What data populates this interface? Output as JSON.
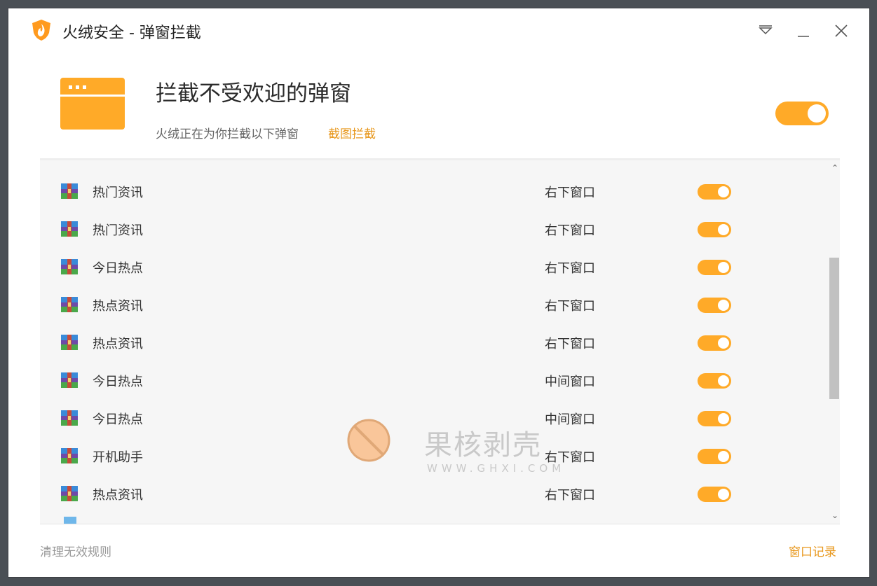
{
  "window": {
    "title": "火绒安全 - 弹窗拦截"
  },
  "header": {
    "title": "拦截不受欢迎的弹窗",
    "subtitle": "火绒正在为你拦截以下弹窗",
    "link": "截图拦截",
    "toggle_on": true
  },
  "rows": [
    {
      "name": "热门资讯",
      "position": "右下窗口",
      "enabled": true
    },
    {
      "name": "热门资讯",
      "position": "右下窗口",
      "enabled": true
    },
    {
      "name": "今日热点",
      "position": "右下窗口",
      "enabled": true
    },
    {
      "name": "热点资讯",
      "position": "右下窗口",
      "enabled": true
    },
    {
      "name": "热点资讯",
      "position": "右下窗口",
      "enabled": true
    },
    {
      "name": "今日热点",
      "position": "中间窗口",
      "enabled": true
    },
    {
      "name": "今日热点",
      "position": "中间窗口",
      "enabled": true
    },
    {
      "name": "开机助手",
      "position": "右下窗口",
      "enabled": true
    },
    {
      "name": "热点资讯",
      "position": "右下窗口",
      "enabled": true
    }
  ],
  "footer": {
    "left": "清理无效规则",
    "right": "窗口记录"
  },
  "watermark": {
    "text": "果核剥壳",
    "url": "WWW.GHXI.COM"
  },
  "colors": {
    "accent": "#ffaa28",
    "link": "#e8981e"
  }
}
